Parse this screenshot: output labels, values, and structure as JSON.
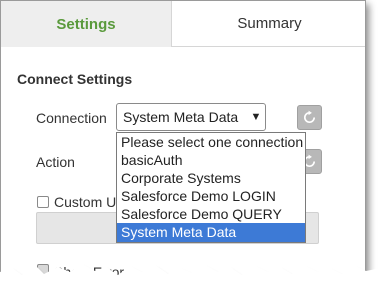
{
  "tabs": {
    "settings_label": "Settings",
    "summary_label": "Summary"
  },
  "section": {
    "title": "Connect Settings"
  },
  "connection": {
    "label": "Connection",
    "selected_value": "System Meta Data",
    "options": [
      "Please select one connection",
      "basicAuth",
      "Corporate Systems",
      "Salesforce Demo LOGIN",
      "Salesforce Demo QUERY",
      "System Meta Data"
    ],
    "selected_index": 5
  },
  "action": {
    "label": "Action"
  },
  "custom": {
    "label": "Custom U"
  },
  "show_error": {
    "label": "Show Error"
  },
  "colors": {
    "accent_green": "#5a9a3c",
    "selection_blue": "#3d7ad6",
    "button_grey": "#b8b8b8"
  },
  "icons": {
    "refresh": "refresh-icon",
    "dropdown_arrow": "triangle-down-icon"
  }
}
